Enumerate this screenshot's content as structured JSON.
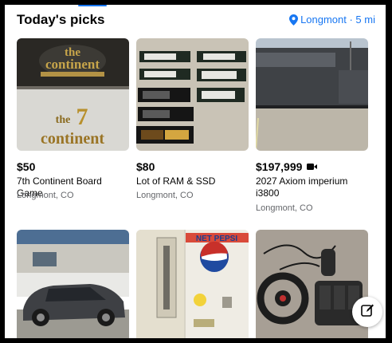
{
  "header": {
    "title": "Today's picks",
    "location": "Longmont · 5 mi",
    "location_icon": "location-pin-icon"
  },
  "colors": {
    "accent": "#1877f2",
    "text": "#050505",
    "secondary_text": "#65676b"
  },
  "listings": [
    {
      "price": "$50",
      "name": "7th Continent Board Game",
      "city": "Longmont, CO",
      "has_video": false
    },
    {
      "price": "$80",
      "name": "Lot of RAM & SSD",
      "city": "Longmont, CO",
      "has_video": false
    },
    {
      "price": "$197,999",
      "name": "2027 Axiom imperium i3800",
      "city": "Longmont, CO",
      "has_video": true
    },
    {
      "price": "",
      "name": "",
      "city": "",
      "has_video": false
    },
    {
      "price": "",
      "name": "",
      "city": "",
      "has_video": false
    },
    {
      "price": "",
      "name": "",
      "city": "",
      "has_video": false
    }
  ],
  "thumb_text": {
    "pepsi_sign": "NET PEPSI"
  },
  "fab": {
    "icon": "compose-icon"
  }
}
